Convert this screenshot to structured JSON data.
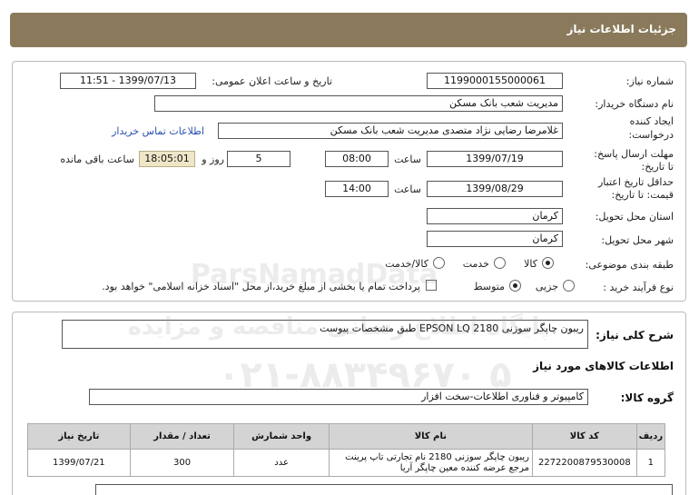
{
  "title": "جزئیات اطلاعات نیاز",
  "fields": {
    "need_number_label": "شماره نیاز:",
    "need_number": "1199000155000061",
    "announce_label": "تاریخ و ساعت اعلان عمومی:",
    "announce_value": "1399/07/13 - 11:51",
    "buyer_org_label": "نام دستگاه خریدار:",
    "buyer_org": "مدیریت شعب بانک مسکن",
    "creator_label_1": "ایجاد کننده",
    "creator_label_2": "درخواست:",
    "creator": "غلامرضا رضایی نژاد متصدی  مدیریت شعب بانک مسکن",
    "contact_link": "اطلاعات تماس خریدار",
    "deadline_label_1": "مهلت ارسال پاسخ:",
    "deadline_label_2": "تا تاریخ:",
    "deadline_date": "1399/07/19",
    "time_label": "ساعت",
    "deadline_time": "08:00",
    "days_value": "5",
    "days_label": "روز و",
    "remaining_time": "18:05:01",
    "remaining_label": "ساعت باقی مانده",
    "validity_label_1": "حداقل تاریخ اعتبار",
    "validity_label_2": "قیمت: تا تاریخ:",
    "validity_date": "1399/08/29",
    "validity_time": "14:00",
    "province_label": "استان محل تحویل:",
    "province": "کرمان",
    "city_label": "شهر محل تحویل:",
    "city": "کرمان",
    "category_label": "طبقه بندی موضوعی:",
    "category_options": [
      "کالا",
      "خدمت",
      "کالا/خدمت"
    ],
    "process_label": "نوع فرآیند خرید :",
    "process_options": [
      "جزیی",
      "متوسط"
    ],
    "payment_note": "پرداخت تمام یا بخشی از مبلغ خرید،از محل \"اسناد خزانه اسلامی\" خواهد بود."
  },
  "summary": {
    "label": "شرح کلی نیاز:",
    "value": "ریبون  چاپگر  سوزنی EPSON LQ 2180 طبق مشخصات پیوست"
  },
  "goods_info_title": "اطلاعات کالاهای مورد نیاز",
  "goods_group": {
    "label": "گروه کالا:",
    "value": "کامپیوتر و فناوری اطلاعات-سخت افزار"
  },
  "table": {
    "headers": [
      "ردیف",
      "کد کالا",
      "نام کالا",
      "واحد شمارش",
      "تعداد / مقدار",
      "تاریخ نیاز"
    ],
    "rows": [
      {
        "row": "1",
        "code": "2272200879530008",
        "name": "ریبون چاپگر سوزنی 2180 نام تجارتی تاپ پرینت مرجع عرضه کننده معین چاپگر آریا",
        "unit": "عدد",
        "qty": "300",
        "date": "1399/07/21"
      }
    ]
  },
  "watermark": {
    "brand": "ParsNamadData",
    "line1": "پایگاه اطلاع رسانی مناقصه و مزایده",
    "line2": "۰۲۱-۸۸۳۴۹۶۷۰ ۵"
  }
}
